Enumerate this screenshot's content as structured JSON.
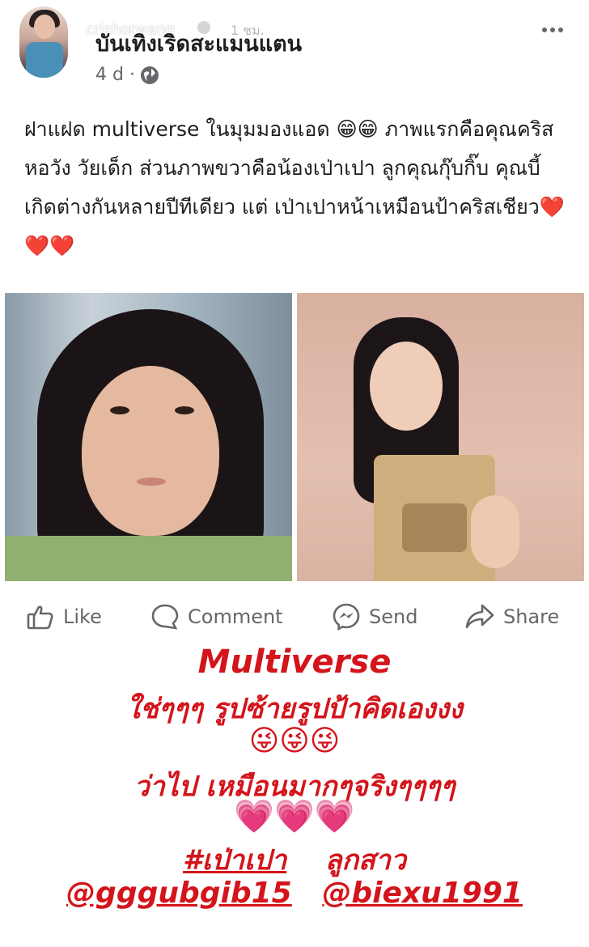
{
  "story_overlay": {
    "username": "crishorwang",
    "time_ago": "1 ชม."
  },
  "post": {
    "page_name": "บันเทิงเริดสะแมนแตน",
    "time": "4 d ·",
    "text": "ฝาแฝด multiverse ในมุมมองแอด 😁😁 ภาพแรกคือคุณคริส หอวัง วัยเด็ก ส่วนภาพขวาคือน้องเป่าเปา ลูกคุณกุ๊บกิ๊บ คุณบี้ เกิดต่างกันหลายปีทีเดียว แต่ เป่าเปาหน้าเหมือนป้าคริสเชียว❤️❤️❤️"
  },
  "actions": {
    "like": "Like",
    "comment": "Comment",
    "send": "Send",
    "share": "Share"
  },
  "caption": {
    "title": "Multiverse",
    "line1": "ใช่ๆๆๆ รูปซ้ายรูปป้าคิดเองงง",
    "emoji_line": "😜😜😜",
    "line2": "ว่าไป เหมือนมากๆจริงๆๆๆๆ",
    "hearts_line": "💗💗💗",
    "hashtag": "#เป่าเปา",
    "hashtag_suffix": "ลูกสาว",
    "mention1": "@gggubgib15",
    "mention2": "@biexu1991"
  },
  "colors": {
    "caption_red": "#d4141b",
    "meta_gray": "#65676b"
  }
}
